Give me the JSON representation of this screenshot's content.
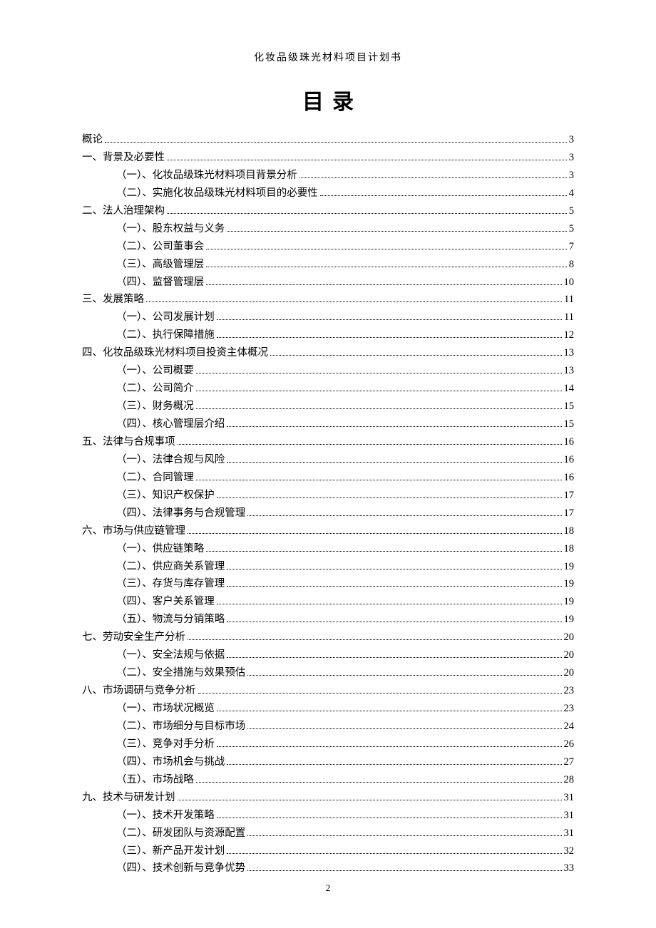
{
  "header": "化妆品级珠光材料项目计划书",
  "title": "目录",
  "page_number": "2",
  "toc": [
    {
      "level": 1,
      "label": "概论 ",
      "page": "3"
    },
    {
      "level": 1,
      "label": "一、背景及必要性 ",
      "page": "3"
    },
    {
      "level": 2,
      "label": "（一）、化妆品级珠光材料项目背景分析",
      "page": "3"
    },
    {
      "level": 2,
      "label": "（二）、实施化妆品级珠光材料项目的必要性 ",
      "page": "4"
    },
    {
      "level": 1,
      "label": "二、法人治理架构 ",
      "page": "5"
    },
    {
      "level": 2,
      "label": "（一）、股东权益与义务",
      "page": "5"
    },
    {
      "level": 2,
      "label": "（二）、公司董事会",
      "page": "7"
    },
    {
      "level": 2,
      "label": "（三）、高级管理层",
      "page": "8"
    },
    {
      "level": 2,
      "label": "（四）、监督管理层",
      "page": "10"
    },
    {
      "level": 1,
      "label": "三、发展策略 ",
      "page": "11"
    },
    {
      "level": 2,
      "label": "（一）、公司发展计划",
      "page": "11"
    },
    {
      "level": 2,
      "label": "（二）、执行保障措施",
      "page": "12"
    },
    {
      "level": 1,
      "label": "四、化妆品级珠光材料项目投资主体概况",
      "page": "13"
    },
    {
      "level": 2,
      "label": "（一）、公司概要 ",
      "page": "13"
    },
    {
      "level": 2,
      "label": "（二）、公司简介 ",
      "page": "14"
    },
    {
      "level": 2,
      "label": "（三）、财务概况 ",
      "page": "15"
    },
    {
      "level": 2,
      "label": "（四）、核心管理层介绍",
      "page": "15"
    },
    {
      "level": 1,
      "label": "五、法律与合规事项 ",
      "page": "16"
    },
    {
      "level": 2,
      "label": "（一）、法律合规与风险",
      "page": "16"
    },
    {
      "level": 2,
      "label": "（二）、合同管理 ",
      "page": "16"
    },
    {
      "level": 2,
      "label": "（三）、知识产权保护",
      "page": "17"
    },
    {
      "level": 2,
      "label": "（四）、法律事务与合规管理",
      "page": "17"
    },
    {
      "level": 1,
      "label": "六、市场与供应链管理",
      "page": "18"
    },
    {
      "level": 2,
      "label": "（一）、供应链策略",
      "page": "18"
    },
    {
      "level": 2,
      "label": "（二）、供应商关系管理",
      "page": "19"
    },
    {
      "level": 2,
      "label": "（三）、存货与库存管理",
      "page": "19"
    },
    {
      "level": 2,
      "label": "（四）、客户关系管理",
      "page": "19"
    },
    {
      "level": 2,
      "label": "（五）、物流与分销策略",
      "page": "19"
    },
    {
      "level": 1,
      "label": "七、劳动安全生产分析",
      "page": "20"
    },
    {
      "level": 2,
      "label": "（一）、安全法规与依据",
      "page": "20"
    },
    {
      "level": 2,
      "label": "（二）、安全措施与效果预估",
      "page": "20"
    },
    {
      "level": 1,
      "label": "八、市场调研与竞争分析",
      "page": "23"
    },
    {
      "level": 2,
      "label": "（一）、市场状况概览",
      "page": "23"
    },
    {
      "level": 2,
      "label": "（二）、市场细分与目标市场",
      "page": "24"
    },
    {
      "level": 2,
      "label": "（三）、竞争对手分析",
      "page": "26"
    },
    {
      "level": 2,
      "label": "（四）、市场机会与挑战",
      "page": "27"
    },
    {
      "level": 2,
      "label": "（五）、市场战略 ",
      "page": "28"
    },
    {
      "level": 1,
      "label": "九、技术与研发计划 ",
      "page": "31"
    },
    {
      "level": 2,
      "label": "（一）、技术开发策略",
      "page": "31"
    },
    {
      "level": 2,
      "label": "（二）、研发团队与资源配置",
      "page": "31"
    },
    {
      "level": 2,
      "label": "（三）、新产品开发计划",
      "page": "32"
    },
    {
      "level": 2,
      "label": "（四）、技术创新与竞争优势",
      "page": "33"
    }
  ]
}
